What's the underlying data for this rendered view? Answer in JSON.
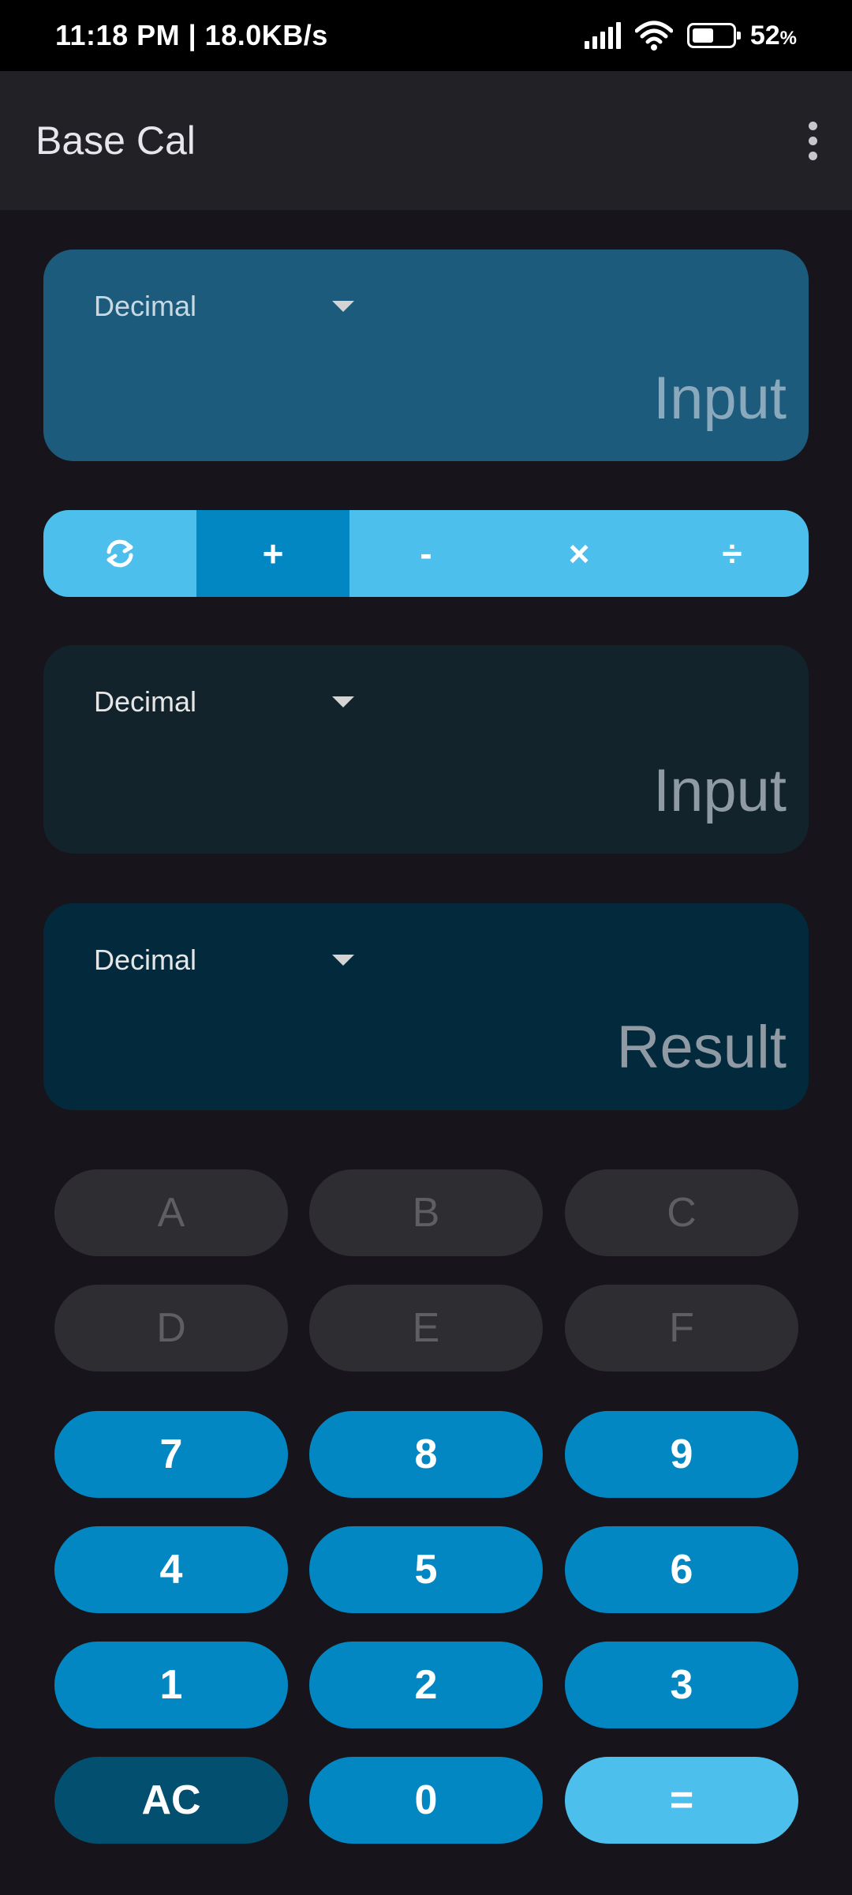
{
  "status_bar": {
    "time_speed": "11:18 PM | 18.0KB/s",
    "battery": "52",
    "battery_unit": "%"
  },
  "app_bar": {
    "title": "Base Cal",
    "overflow_icon": "more-vert-icon"
  },
  "input1": {
    "base": "Decimal",
    "placeholder": "Input"
  },
  "operations": [
    {
      "label": "⟳",
      "icon": "swap-icon",
      "selected": false
    },
    {
      "label": "+",
      "selected": true
    },
    {
      "label": "-",
      "selected": false
    },
    {
      "label": "×",
      "selected": false
    },
    {
      "label": "÷",
      "selected": false
    }
  ],
  "input2": {
    "base": "Decimal",
    "placeholder": "Input"
  },
  "result": {
    "base": "Decimal",
    "placeholder": "Result"
  },
  "keypad": {
    "a": "A",
    "b": "B",
    "c": "C",
    "d": "D",
    "e": "E",
    "f": "F",
    "k7": "7",
    "k8": "8",
    "k9": "9",
    "k4": "4",
    "k5": "5",
    "k6": "6",
    "k1": "1",
    "k2": "2",
    "k3": "3",
    "ac": "AC",
    "k0": "0",
    "eq": "="
  },
  "colors": {
    "accent": "#0287c3",
    "accent_light": "#4dbfec",
    "ac_button": "#034f70",
    "background": "#17151b"
  }
}
